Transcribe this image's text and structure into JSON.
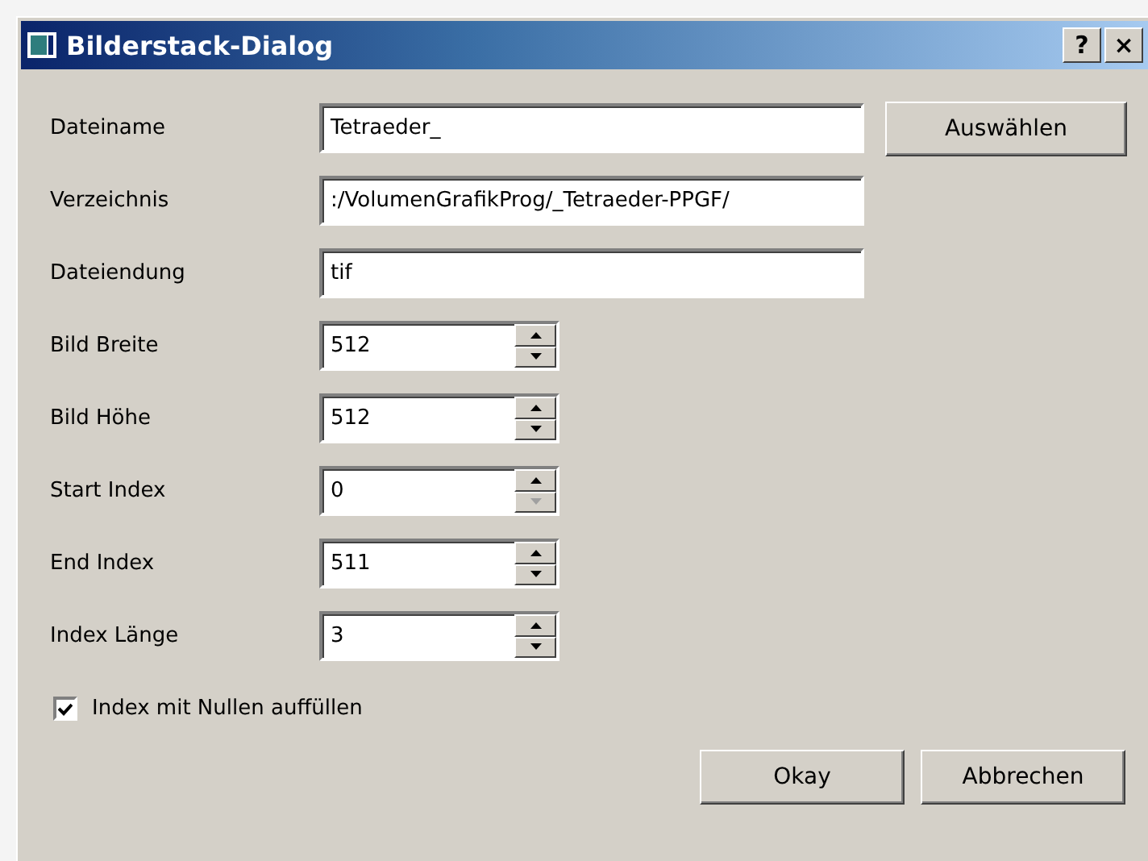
{
  "window": {
    "title": "Bilderstack-Dialog",
    "help_button": "?",
    "close_button": "×"
  },
  "fields": [
    {
      "kind": "text",
      "label": "Dateiname",
      "value": "Tetraeder_",
      "button": "Auswählen"
    },
    {
      "kind": "text",
      "label": "Verzeichnis",
      "value": ":/VolumenGrafikProg/_Tetraeder-PPGF/"
    },
    {
      "kind": "text",
      "label": "Dateiendung",
      "value": "tif"
    },
    {
      "kind": "spin",
      "label": "Bild Breite",
      "value": "512",
      "down_disabled": false
    },
    {
      "kind": "spin",
      "label": "Bild Höhe",
      "value": "512",
      "down_disabled": false
    },
    {
      "kind": "spin",
      "label": "Start Index",
      "value": "0",
      "down_disabled": true
    },
    {
      "kind": "spin",
      "label": "End Index",
      "value": "511",
      "down_disabled": false
    },
    {
      "kind": "spin",
      "label": "Index Länge",
      "value": "3",
      "down_disabled": false
    }
  ],
  "checkbox": {
    "label": "Index mit Nullen auffüllen",
    "checked": true
  },
  "buttons": [
    "Okay",
    "Abbrechen"
  ]
}
